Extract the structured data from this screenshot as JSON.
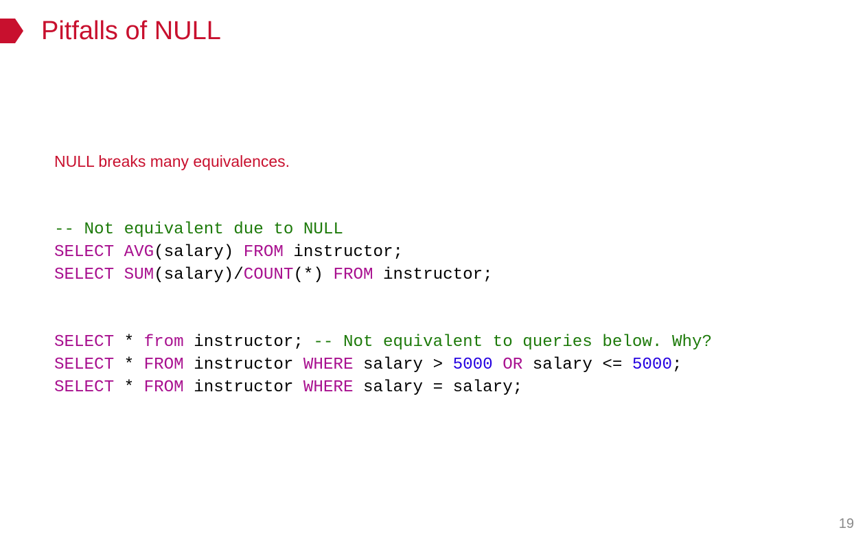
{
  "slide": {
    "title": "Pitfalls of NULL",
    "subtitle": "NULL breaks many equivalences.",
    "page_number": "19",
    "colors": {
      "accent": "#c8102e",
      "keyword": "#a8108f",
      "comment": "#1d7a0a",
      "number": "#2400e0"
    }
  },
  "code_blocks": [
    [
      [
        {
          "t": "-- Not equivalent due to NULL",
          "c": "cm"
        }
      ],
      [
        {
          "t": "SELECT",
          "c": "kw"
        },
        {
          "t": " ",
          "c": "plain"
        },
        {
          "t": "AVG",
          "c": "kw"
        },
        {
          "t": "(salary) ",
          "c": "plain"
        },
        {
          "t": "FROM",
          "c": "kw"
        },
        {
          "t": " instructor;",
          "c": "plain"
        }
      ],
      [
        {
          "t": "SELECT",
          "c": "kw"
        },
        {
          "t": " ",
          "c": "plain"
        },
        {
          "t": "SUM",
          "c": "kw"
        },
        {
          "t": "(salary)/",
          "c": "plain"
        },
        {
          "t": "COUNT",
          "c": "kw"
        },
        {
          "t": "(*) ",
          "c": "plain"
        },
        {
          "t": "FROM",
          "c": "kw"
        },
        {
          "t": " instructor;",
          "c": "plain"
        }
      ]
    ],
    [
      [
        {
          "t": "SELECT",
          "c": "kw"
        },
        {
          "t": " * ",
          "c": "plain"
        },
        {
          "t": "from",
          "c": "kw"
        },
        {
          "t": " instructor; ",
          "c": "plain"
        },
        {
          "t": "-- Not equivalent to queries below. Why?",
          "c": "cm"
        }
      ],
      [
        {
          "t": "SELECT",
          "c": "kw"
        },
        {
          "t": " * ",
          "c": "plain"
        },
        {
          "t": "FROM",
          "c": "kw"
        },
        {
          "t": " instructor ",
          "c": "plain"
        },
        {
          "t": "WHERE",
          "c": "kw"
        },
        {
          "t": " salary > ",
          "c": "plain"
        },
        {
          "t": "5000",
          "c": "num"
        },
        {
          "t": " ",
          "c": "plain"
        },
        {
          "t": "OR",
          "c": "kw"
        },
        {
          "t": " salary <= ",
          "c": "plain"
        },
        {
          "t": "5000",
          "c": "num"
        },
        {
          "t": ";",
          "c": "plain"
        }
      ],
      [
        {
          "t": "SELECT",
          "c": "kw"
        },
        {
          "t": " * ",
          "c": "plain"
        },
        {
          "t": "FROM",
          "c": "kw"
        },
        {
          "t": " instructor ",
          "c": "plain"
        },
        {
          "t": "WHERE",
          "c": "kw"
        },
        {
          "t": " salary = salary;",
          "c": "plain"
        }
      ]
    ]
  ]
}
